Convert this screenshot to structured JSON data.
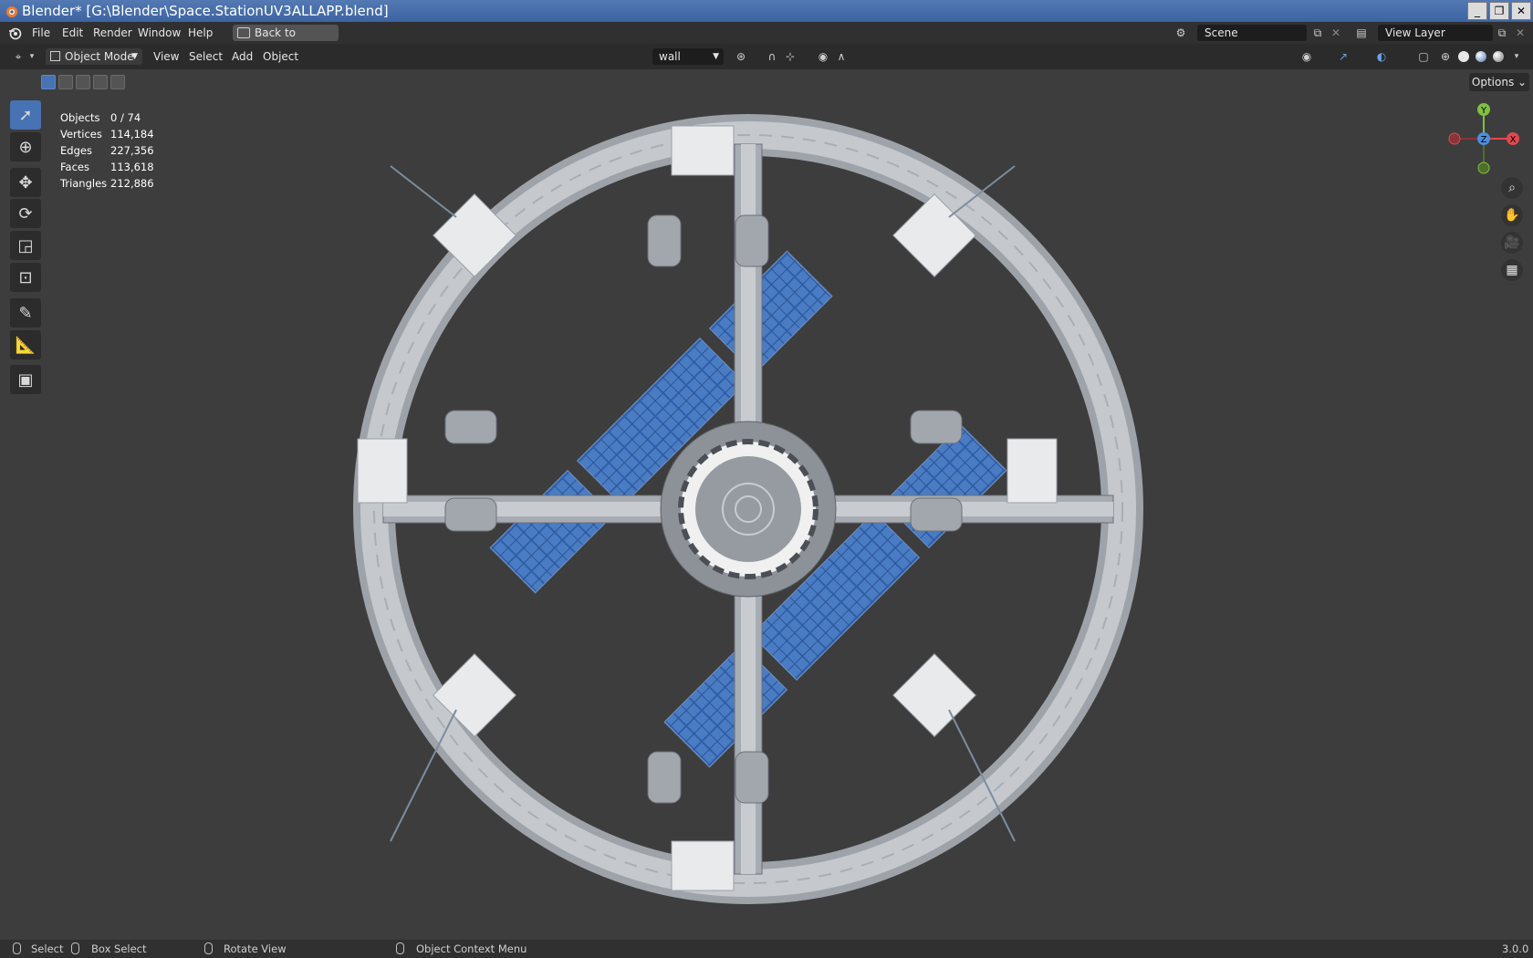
{
  "window": {
    "title": "Blender* [G:\\Blender\\Space.StationUV3ALLAPP.blend]",
    "controls": [
      "_",
      "❐",
      "✕"
    ]
  },
  "menubar": {
    "items": [
      "File",
      "Edit",
      "Render",
      "Window",
      "Help"
    ],
    "back_button": "Back to Previous",
    "scene": "Scene",
    "view_layer": "View Layer"
  },
  "viewport_header": {
    "mode": "Object Mode",
    "menus": [
      "View",
      "Select",
      "Add",
      "Object"
    ],
    "transform_orientation": "wall",
    "options": "Options"
  },
  "stats": [
    {
      "label": "Objects",
      "value": "0 / 74"
    },
    {
      "label": "Vertices",
      "value": "114,184"
    },
    {
      "label": "Edges",
      "value": "227,356"
    },
    {
      "label": "Faces",
      "value": "113,618"
    },
    {
      "label": "Triangles",
      "value": "212,886"
    }
  ],
  "gizmo": {
    "y": "Y",
    "x": "X",
    "z": "Z"
  },
  "statusbar": {
    "select": "Select",
    "box_select": "Box Select",
    "rotate_view": "Rotate View",
    "context_menu": "Object Context Menu",
    "version": "3.0.0"
  },
  "icons": {
    "toolbar": [
      "select-box-icon",
      "cursor-icon",
      "move-icon",
      "rotate-icon",
      "scale-icon",
      "transform-icon",
      "annotate-icon",
      "measure-icon",
      "add-cube-icon"
    ],
    "navigation": [
      "zoom-icon",
      "hand-pan-icon",
      "camera-icon",
      "ortho-grid-icon"
    ]
  },
  "colors": {
    "accent": "#4772b3",
    "titlebar": "#4a6fac",
    "viewport": "#3d3d3d",
    "solar": "#3e6fb8",
    "x_axis": "#e2484f",
    "y_axis": "#80c040",
    "z_axis": "#4a8fe0"
  }
}
